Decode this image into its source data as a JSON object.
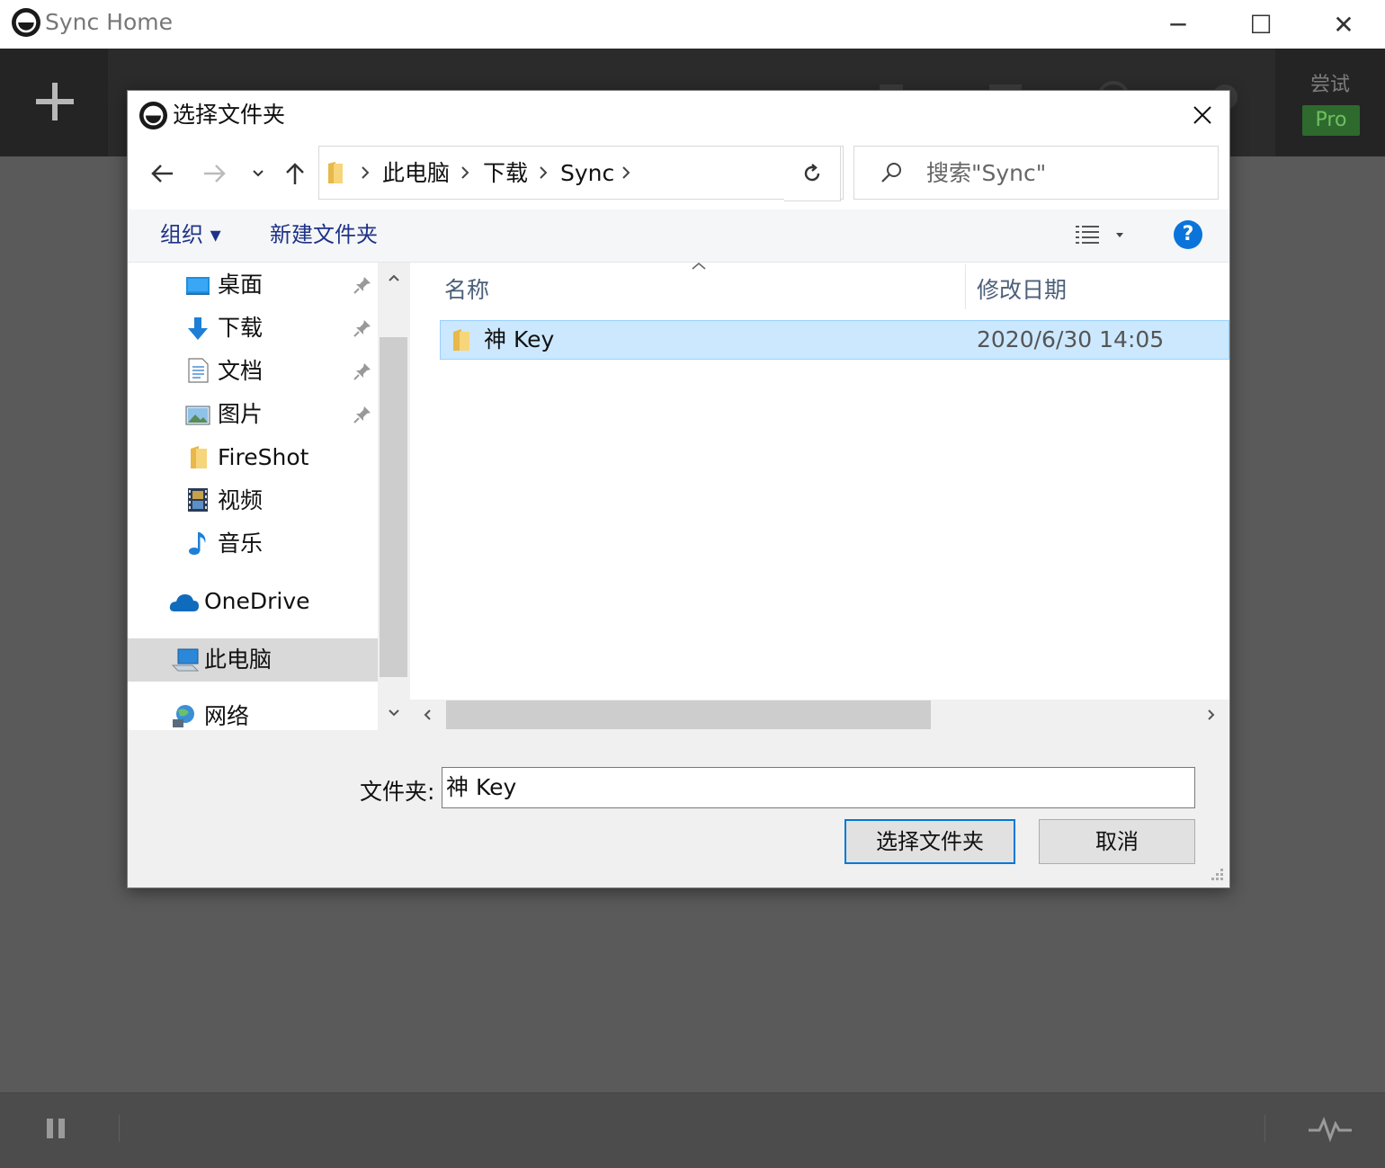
{
  "window": {
    "title": "Sync Home",
    "minimize_label": "─",
    "maximize_label": "☐",
    "close_label": "✕"
  },
  "toolbar": {
    "try_label": "尝试",
    "pro_label": "Pro"
  },
  "dialog": {
    "title": "选择文件夹",
    "address": {
      "crumbs": [
        "此电脑",
        "下载",
        "Sync"
      ]
    },
    "search": {
      "placeholder": "搜索\"Sync\""
    },
    "commands": {
      "organize": "组织 ▾",
      "new_folder": "新建文件夹"
    },
    "nav_pane": {
      "quick_access": [
        {
          "label": "桌面",
          "icon": "desktop-icon",
          "pinned": true
        },
        {
          "label": "下载",
          "icon": "download-icon",
          "pinned": true
        },
        {
          "label": "文档",
          "icon": "document-icon",
          "pinned": true
        },
        {
          "label": "图片",
          "icon": "pictures-icon",
          "pinned": true
        },
        {
          "label": "FireShot",
          "icon": "folder-icon",
          "pinned": false
        },
        {
          "label": "视频",
          "icon": "video-icon",
          "pinned": false
        },
        {
          "label": "音乐",
          "icon": "music-icon",
          "pinned": false
        }
      ],
      "onedrive": "OneDrive",
      "this_pc": "此电脑",
      "network": "网络"
    },
    "file_list": {
      "columns": {
        "name": "名称",
        "modified": "修改日期"
      },
      "rows": [
        {
          "name": "神 Key",
          "modified": "2020/6/30 14:05",
          "selected": true
        }
      ]
    },
    "folder_label": "文件夹:",
    "folder_value": "神 Key",
    "select_button": "选择文件夹",
    "cancel_button": "取消"
  },
  "colors": {
    "selection": "#cce8ff",
    "command_text": "#1e3287",
    "pro_badge": "#2e6a2e",
    "help_blue": "#0a74da"
  }
}
